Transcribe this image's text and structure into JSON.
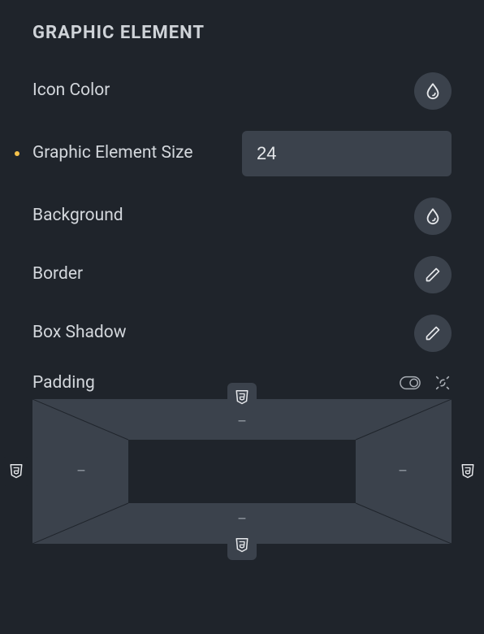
{
  "section_title": "GRAPHIC ELEMENT",
  "rows": {
    "icon_color": "Icon Color",
    "size_label": "Graphic Element Size",
    "size_value": "24",
    "background": "Background",
    "border": "Border",
    "box_shadow": "Box Shadow",
    "padding": "Padding"
  },
  "padding_vals": {
    "top": "–",
    "right": "–",
    "bottom": "–",
    "left": "–"
  }
}
